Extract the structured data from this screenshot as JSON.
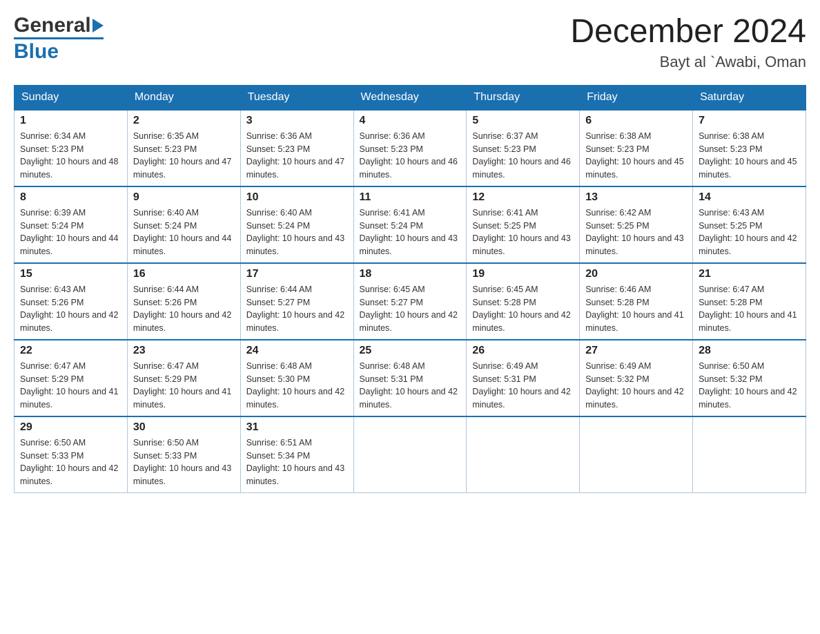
{
  "header": {
    "logo_general": "General",
    "logo_triangle": "▶",
    "logo_blue": "Blue",
    "month_title": "December 2024",
    "location": "Bayt al `Awabi, Oman"
  },
  "days_of_week": [
    "Sunday",
    "Monday",
    "Tuesday",
    "Wednesday",
    "Thursday",
    "Friday",
    "Saturday"
  ],
  "weeks": [
    [
      {
        "day": "1",
        "sunrise": "Sunrise: 6:34 AM",
        "sunset": "Sunset: 5:23 PM",
        "daylight": "Daylight: 10 hours and 48 minutes."
      },
      {
        "day": "2",
        "sunrise": "Sunrise: 6:35 AM",
        "sunset": "Sunset: 5:23 PM",
        "daylight": "Daylight: 10 hours and 47 minutes."
      },
      {
        "day": "3",
        "sunrise": "Sunrise: 6:36 AM",
        "sunset": "Sunset: 5:23 PM",
        "daylight": "Daylight: 10 hours and 47 minutes."
      },
      {
        "day": "4",
        "sunrise": "Sunrise: 6:36 AM",
        "sunset": "Sunset: 5:23 PM",
        "daylight": "Daylight: 10 hours and 46 minutes."
      },
      {
        "day": "5",
        "sunrise": "Sunrise: 6:37 AM",
        "sunset": "Sunset: 5:23 PM",
        "daylight": "Daylight: 10 hours and 46 minutes."
      },
      {
        "day": "6",
        "sunrise": "Sunrise: 6:38 AM",
        "sunset": "Sunset: 5:23 PM",
        "daylight": "Daylight: 10 hours and 45 minutes."
      },
      {
        "day": "7",
        "sunrise": "Sunrise: 6:38 AM",
        "sunset": "Sunset: 5:23 PM",
        "daylight": "Daylight: 10 hours and 45 minutes."
      }
    ],
    [
      {
        "day": "8",
        "sunrise": "Sunrise: 6:39 AM",
        "sunset": "Sunset: 5:24 PM",
        "daylight": "Daylight: 10 hours and 44 minutes."
      },
      {
        "day": "9",
        "sunrise": "Sunrise: 6:40 AM",
        "sunset": "Sunset: 5:24 PM",
        "daylight": "Daylight: 10 hours and 44 minutes."
      },
      {
        "day": "10",
        "sunrise": "Sunrise: 6:40 AM",
        "sunset": "Sunset: 5:24 PM",
        "daylight": "Daylight: 10 hours and 43 minutes."
      },
      {
        "day": "11",
        "sunrise": "Sunrise: 6:41 AM",
        "sunset": "Sunset: 5:24 PM",
        "daylight": "Daylight: 10 hours and 43 minutes."
      },
      {
        "day": "12",
        "sunrise": "Sunrise: 6:41 AM",
        "sunset": "Sunset: 5:25 PM",
        "daylight": "Daylight: 10 hours and 43 minutes."
      },
      {
        "day": "13",
        "sunrise": "Sunrise: 6:42 AM",
        "sunset": "Sunset: 5:25 PM",
        "daylight": "Daylight: 10 hours and 43 minutes."
      },
      {
        "day": "14",
        "sunrise": "Sunrise: 6:43 AM",
        "sunset": "Sunset: 5:25 PM",
        "daylight": "Daylight: 10 hours and 42 minutes."
      }
    ],
    [
      {
        "day": "15",
        "sunrise": "Sunrise: 6:43 AM",
        "sunset": "Sunset: 5:26 PM",
        "daylight": "Daylight: 10 hours and 42 minutes."
      },
      {
        "day": "16",
        "sunrise": "Sunrise: 6:44 AM",
        "sunset": "Sunset: 5:26 PM",
        "daylight": "Daylight: 10 hours and 42 minutes."
      },
      {
        "day": "17",
        "sunrise": "Sunrise: 6:44 AM",
        "sunset": "Sunset: 5:27 PM",
        "daylight": "Daylight: 10 hours and 42 minutes."
      },
      {
        "day": "18",
        "sunrise": "Sunrise: 6:45 AM",
        "sunset": "Sunset: 5:27 PM",
        "daylight": "Daylight: 10 hours and 42 minutes."
      },
      {
        "day": "19",
        "sunrise": "Sunrise: 6:45 AM",
        "sunset": "Sunset: 5:28 PM",
        "daylight": "Daylight: 10 hours and 42 minutes."
      },
      {
        "day": "20",
        "sunrise": "Sunrise: 6:46 AM",
        "sunset": "Sunset: 5:28 PM",
        "daylight": "Daylight: 10 hours and 41 minutes."
      },
      {
        "day": "21",
        "sunrise": "Sunrise: 6:47 AM",
        "sunset": "Sunset: 5:28 PM",
        "daylight": "Daylight: 10 hours and 41 minutes."
      }
    ],
    [
      {
        "day": "22",
        "sunrise": "Sunrise: 6:47 AM",
        "sunset": "Sunset: 5:29 PM",
        "daylight": "Daylight: 10 hours and 41 minutes."
      },
      {
        "day": "23",
        "sunrise": "Sunrise: 6:47 AM",
        "sunset": "Sunset: 5:29 PM",
        "daylight": "Daylight: 10 hours and 41 minutes."
      },
      {
        "day": "24",
        "sunrise": "Sunrise: 6:48 AM",
        "sunset": "Sunset: 5:30 PM",
        "daylight": "Daylight: 10 hours and 42 minutes."
      },
      {
        "day": "25",
        "sunrise": "Sunrise: 6:48 AM",
        "sunset": "Sunset: 5:31 PM",
        "daylight": "Daylight: 10 hours and 42 minutes."
      },
      {
        "day": "26",
        "sunrise": "Sunrise: 6:49 AM",
        "sunset": "Sunset: 5:31 PM",
        "daylight": "Daylight: 10 hours and 42 minutes."
      },
      {
        "day": "27",
        "sunrise": "Sunrise: 6:49 AM",
        "sunset": "Sunset: 5:32 PM",
        "daylight": "Daylight: 10 hours and 42 minutes."
      },
      {
        "day": "28",
        "sunrise": "Sunrise: 6:50 AM",
        "sunset": "Sunset: 5:32 PM",
        "daylight": "Daylight: 10 hours and 42 minutes."
      }
    ],
    [
      {
        "day": "29",
        "sunrise": "Sunrise: 6:50 AM",
        "sunset": "Sunset: 5:33 PM",
        "daylight": "Daylight: 10 hours and 42 minutes."
      },
      {
        "day": "30",
        "sunrise": "Sunrise: 6:50 AM",
        "sunset": "Sunset: 5:33 PM",
        "daylight": "Daylight: 10 hours and 43 minutes."
      },
      {
        "day": "31",
        "sunrise": "Sunrise: 6:51 AM",
        "sunset": "Sunset: 5:34 PM",
        "daylight": "Daylight: 10 hours and 43 minutes."
      },
      null,
      null,
      null,
      null
    ]
  ]
}
